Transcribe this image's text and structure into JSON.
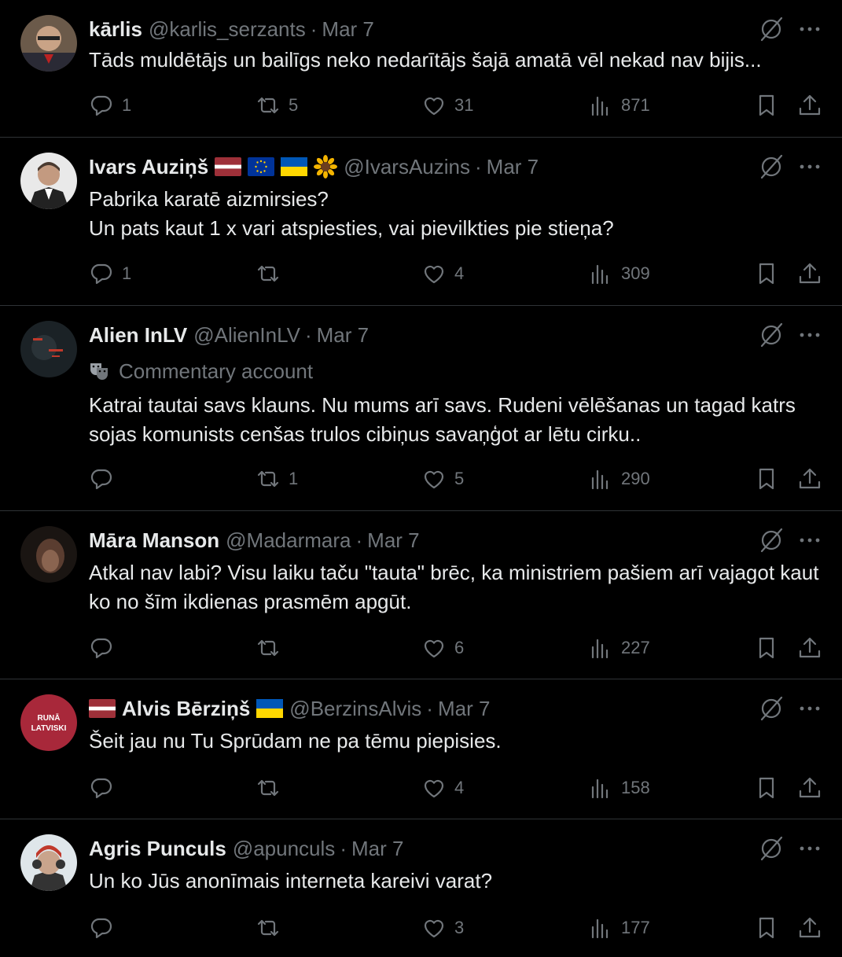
{
  "tweets": [
    {
      "name": "kārlis",
      "handle": "@karlis_serzants",
      "date": "Mar 7",
      "text": "Tāds muldētājs un bailīgs neko nedarītājs šajā amatā vēl nekad nav bijis...",
      "replies": "1",
      "reposts": "5",
      "likes": "31",
      "views": "871"
    },
    {
      "name": "Ivars Auziņš",
      "name_emojis": [
        "flag-latvia",
        "flag-eu",
        "flag-ukraine",
        "sunflower"
      ],
      "handle": "@IvarsAuzins",
      "date": "Mar 7",
      "text": "Pabrika karatē aizmirsies?\nUn pats kaut 1 x vari atspiesties, vai pievilkties pie stieņa?",
      "replies": "1",
      "reposts": "",
      "likes": "4",
      "views": "309"
    },
    {
      "name": "Alien InLV",
      "handle": "@AlienInLV",
      "date": "Mar 7",
      "badge": "Commentary account",
      "badge_icon": "theater-masks-icon",
      "text": "Katrai tautai savs klauns. Nu mums arī savs. Rudeni vēlēšanas un tagad katrs sojas komunists cenšas trulos cibiņus savaņģot ar lētu cirku..",
      "replies": "",
      "reposts": "1",
      "likes": "5",
      "views": "290"
    },
    {
      "name": "Māra Manson",
      "handle": "@Madarmara",
      "date": "Mar 7",
      "text": "Atkal nav labi? Visu laiku taču \"tauta\" brēc, ka ministriem pašiem arī vajagot kaut ko no šīm ikdienas prasmēm apgūt.",
      "replies": "",
      "reposts": "",
      "likes": "6",
      "views": "227"
    },
    {
      "name": "Alvis Bērziņš",
      "name_emojis_before": [
        "flag-latvia"
      ],
      "name_emojis": [
        "flag-ukraine"
      ],
      "handle": "@BerzinsAlvis",
      "date": "Mar 7",
      "avatar_text": [
        "RUNĀ",
        "LATVISKI"
      ],
      "text": "Šeit jau nu Tu Sprūdam ne pa tēmu piepisies.",
      "replies": "",
      "reposts": "",
      "likes": "4",
      "views": "158"
    },
    {
      "name": "Agris Punculs",
      "handle": "@apunculs",
      "date": "Mar 7",
      "text": "Un ko Jūs anonīmais interneta kareivi varat?",
      "replies": "",
      "reposts": "",
      "likes": "3",
      "views": "177"
    }
  ],
  "separator": "·",
  "colors": {
    "background": "#000000",
    "text": "#e7e9ea",
    "secondary": "#71767b",
    "divider": "#2f3336"
  }
}
